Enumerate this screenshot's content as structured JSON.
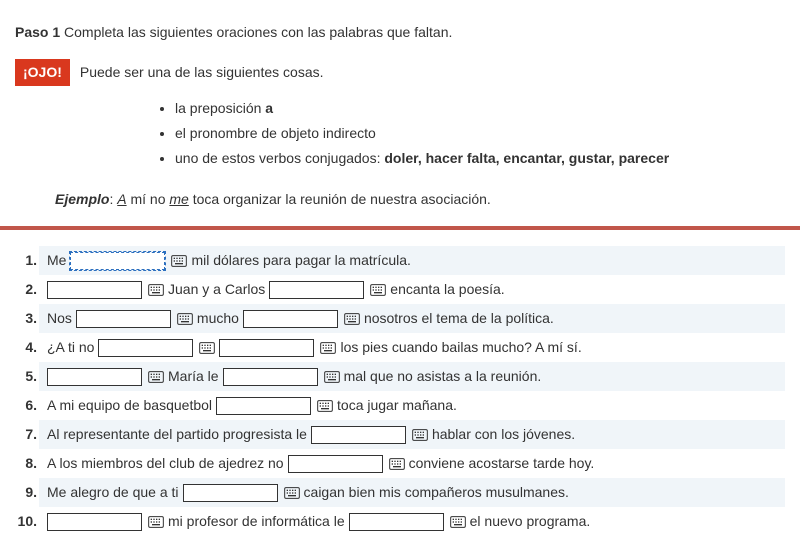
{
  "header": {
    "paso_label": "Paso 1",
    "paso_text": "Completa las siguientes oraciones con las palabras que faltan.",
    "ojo_label": "¡OJO!",
    "ojo_text": "Puede ser una de las siguientes cosas."
  },
  "bullets": {
    "b1_pre": "la preposición ",
    "b1_bold": "a",
    "b2": "el pronombre de objeto indirecto",
    "b3_pre": "uno de estos verbos conjugados: ",
    "b3_bold": "doler, hacer falta, encantar, gustar, parecer"
  },
  "example": {
    "label": "Ejemplo",
    "colon": ": ",
    "u1": "A",
    "t1": " mí no ",
    "u2": "me",
    "t2": " toca organizar la reunión de nuestra asociación."
  },
  "questions": {
    "q1": {
      "a": "Me",
      "b": "mil dólares para pagar la matrícula."
    },
    "q2": {
      "a": "Juan y a Carlos",
      "b": "encanta la poesía."
    },
    "q3": {
      "a": "Nos",
      "b": "mucho",
      "c": "nosotros el tema de la política."
    },
    "q4": {
      "a": "¿A ti no",
      "b": "los pies cuando bailas mucho? A mí sí."
    },
    "q5": {
      "a": "María le",
      "b": "mal que no asistas a la reunión."
    },
    "q6": {
      "a": "A mi equipo de basquetbol",
      "b": "toca jugar mañana."
    },
    "q7": {
      "a": "Al representante del partido progresista le",
      "b": "hablar con los jóvenes."
    },
    "q8": {
      "a": "A los miembros del club de ajedrez no",
      "b": "conviene acostarse tarde hoy."
    },
    "q9": {
      "a": "Me alegro de que a ti",
      "b": "caigan bien mis compañeros musulmanes."
    },
    "q10": {
      "a": "mi profesor de informática le",
      "b": "el nuevo programa."
    }
  }
}
